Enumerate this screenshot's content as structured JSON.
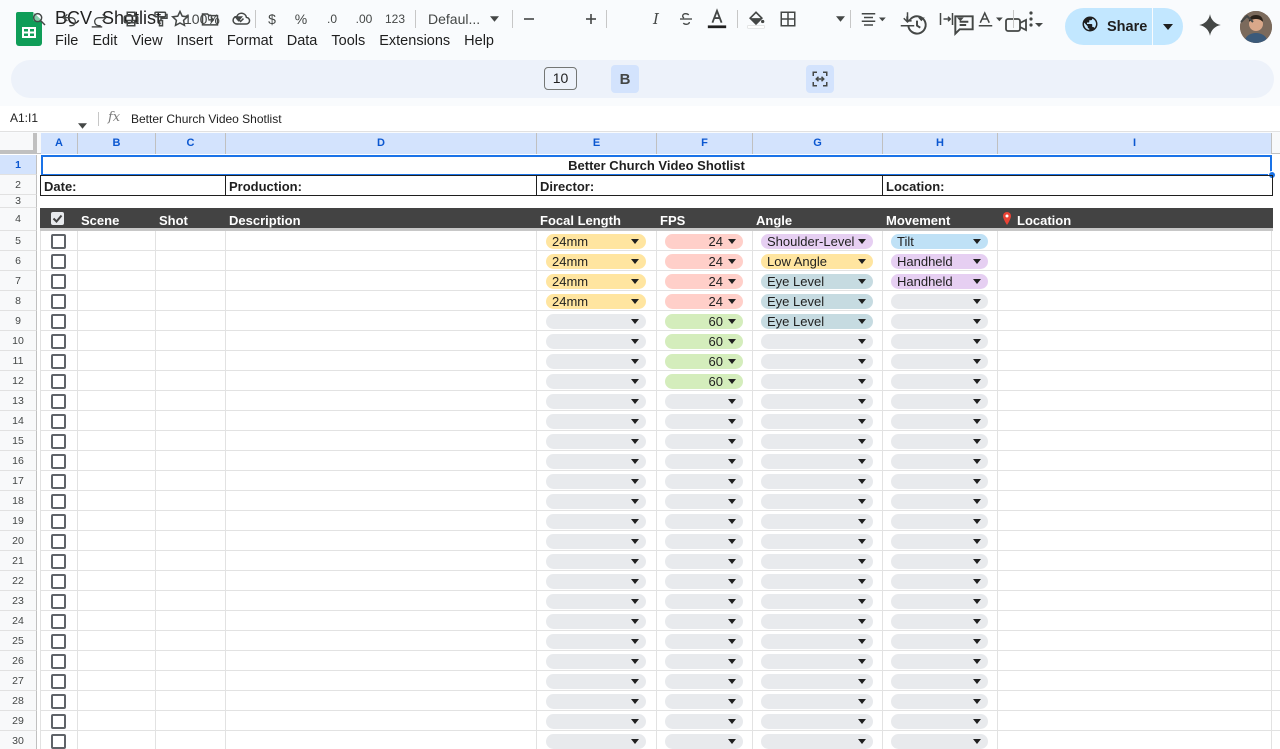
{
  "app": {
    "doc_title": "BCV_Shotlist",
    "menu": [
      "File",
      "Edit",
      "View",
      "Insert",
      "Format",
      "Data",
      "Tools",
      "Extensions",
      "Help"
    ],
    "share_label": "Share"
  },
  "toolbar": {
    "zoom": "100%",
    "currency": "$",
    "percent": "%",
    "decrease_decimal": ".0",
    "increase_decimal": ".00",
    "number_format": "123",
    "font": "Defaul...",
    "font_size": "10",
    "bold": "B",
    "italic": "I"
  },
  "formula_bar": {
    "name_box": "A1:I1",
    "fx": "fx",
    "value": "Better Church Video Shotlist"
  },
  "columns": [
    "A",
    "B",
    "C",
    "D",
    "E",
    "F",
    "G",
    "H",
    "I"
  ],
  "rows": [
    "1",
    "2",
    "3",
    "4",
    "5",
    "6",
    "7",
    "8",
    "9",
    "10",
    "11",
    "12",
    "13",
    "14",
    "15",
    "16",
    "17",
    "18",
    "19",
    "20",
    "21",
    "22",
    "23",
    "24",
    "25",
    "26",
    "27",
    "28",
    "29",
    "30"
  ],
  "sheet": {
    "title": "Better Church Video Shotlist",
    "date_label": "Date:",
    "production_label": "Production:",
    "director_label": "Director:",
    "location_label": "Location:",
    "headers": {
      "scene": "Scene",
      "shot": "Shot",
      "description": "Description",
      "focal_length": "Focal Length",
      "fps": "FPS",
      "angle": "Angle",
      "movement": "Movement",
      "location": "Location"
    },
    "shots": [
      {
        "focal": "24mm",
        "fps": "24",
        "angle": "Shoulder-Level",
        "movement": "Tilt"
      },
      {
        "focal": "24mm",
        "fps": "24",
        "angle": "Low Angle",
        "movement": "Handheld"
      },
      {
        "focal": "24mm",
        "fps": "24",
        "angle": "Eye Level",
        "movement": "Handheld"
      },
      {
        "focal": "24mm",
        "fps": "24",
        "angle": "Eye Level",
        "movement": ""
      },
      {
        "focal": "",
        "fps": "60",
        "angle": "Eye Level",
        "movement": ""
      },
      {
        "focal": "",
        "fps": "60",
        "angle": "",
        "movement": ""
      },
      {
        "focal": "",
        "fps": "60",
        "angle": "",
        "movement": ""
      },
      {
        "focal": "",
        "fps": "60",
        "angle": "",
        "movement": ""
      }
    ]
  },
  "colors": {
    "header_band": "#434343",
    "focal_chip": "#ffe5a0",
    "fps_24_chip": "#ffcfc9",
    "fps_60_chip": "#d4edbc",
    "angle_purple": "#e6cff2",
    "angle_yellow": "#ffe5a0",
    "angle_blue": "#c6dbe1",
    "movement_blue": "#bfe1f6",
    "movement_purple": "#e6cff2",
    "empty_chip": "#e8eaed",
    "share_bg": "#c2e7ff"
  }
}
